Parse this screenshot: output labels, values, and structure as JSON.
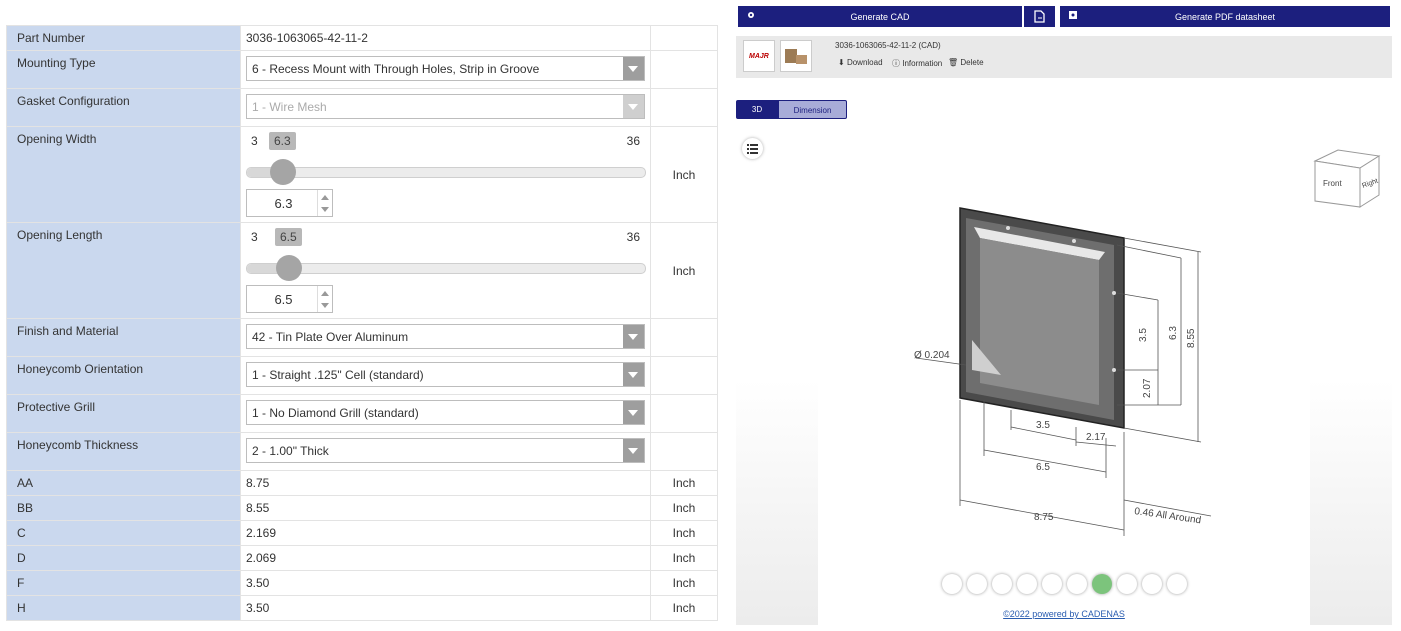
{
  "config": {
    "part_number": {
      "label": "Part Number",
      "value": "3036-1063065-42-11-2"
    },
    "mounting_type": {
      "label": "Mounting Type",
      "value": "6 - Recess Mount with Through Holes, Strip in Groove"
    },
    "gasket": {
      "label": "Gasket Configuration",
      "value": "1 - Wire Mesh"
    },
    "opening_width": {
      "label": "Opening Width",
      "min": "3",
      "max": "36",
      "value": "6.3",
      "fraction": 0.0909,
      "unit": "Inch"
    },
    "opening_length": {
      "label": "Opening Length",
      "min": "3",
      "max": "36",
      "value": "6.5",
      "fraction": 0.1061,
      "unit": "Inch"
    },
    "finish": {
      "label": "Finish and Material",
      "value": "42 - Tin Plate Over Aluminum"
    },
    "honeycomb_orientation": {
      "label": "Honeycomb Orientation",
      "value": "1 - Straight .125\" Cell (standard)"
    },
    "grill": {
      "label": "Protective Grill",
      "value": "1 - No Diamond Grill (standard)"
    },
    "honeycomb_thickness": {
      "label": "Honeycomb Thickness",
      "value": "2 - 1.00\" Thick"
    },
    "dims": [
      {
        "label": "AA",
        "value": "8.75",
        "unit": "Inch"
      },
      {
        "label": "BB",
        "value": "8.55",
        "unit": "Inch"
      },
      {
        "label": "C",
        "value": "2.169",
        "unit": "Inch"
      },
      {
        "label": "D",
        "value": "2.069",
        "unit": "Inch"
      },
      {
        "label": "F",
        "value": "3.50",
        "unit": "Inch"
      },
      {
        "label": "H",
        "value": "3.50",
        "unit": "Inch"
      }
    ]
  },
  "toolbar": {
    "generate_cad": "Generate CAD",
    "generate_pdf": "Generate PDF datasheet"
  },
  "cad_item": {
    "name": "3036-1063065-42-11-2 (CAD)",
    "logo_text": "MAJR",
    "download": "Download",
    "information": "Information",
    "delete": "Delete"
  },
  "viewer": {
    "tab_3d": "3D",
    "tab_dimension": "Dimension",
    "cube_front": "Front",
    "cube_right": "Right",
    "dims": {
      "d1": "3.5",
      "d2": "6.3",
      "d3": "8.55",
      "d4": "2.07",
      "d5": "3.5",
      "d6": "2.17",
      "d7": "6.5",
      "d8": "8.75",
      "dia": "Ø 0.204",
      "around": "0.46 All Around"
    },
    "credit": "©2022 powered by CADENAS"
  },
  "colors": {
    "label_bg": "#cad8ee",
    "brand": "#1c1f7e",
    "tab_dim": "#a8acd8"
  }
}
